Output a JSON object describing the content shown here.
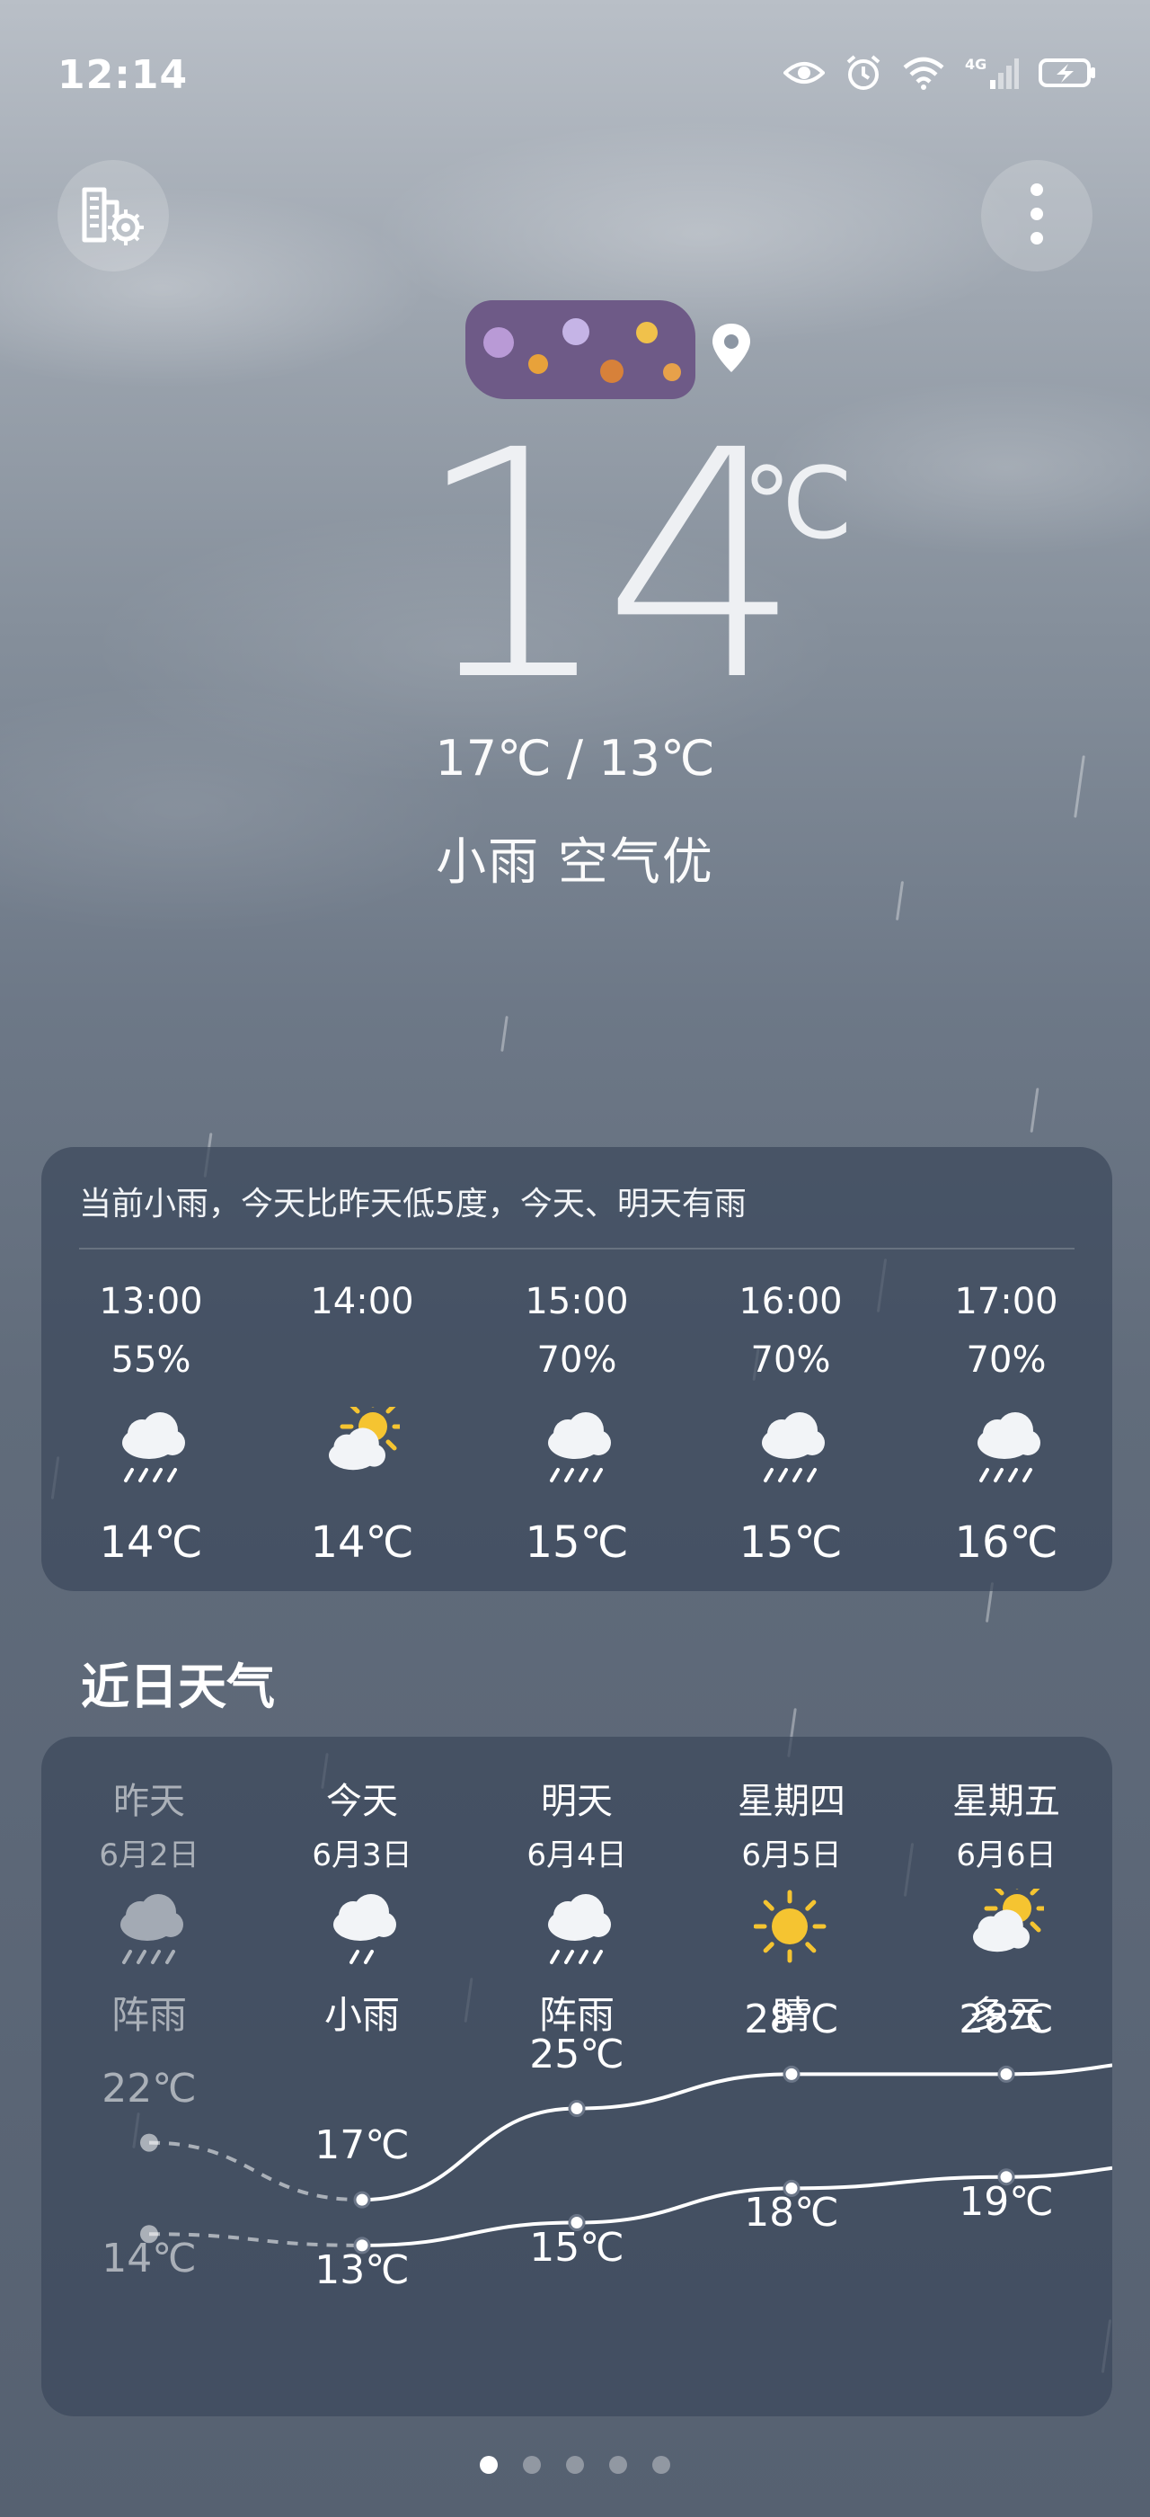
{
  "status_bar": {
    "time": "12:14",
    "network": "4G",
    "icons": [
      "eye-icon",
      "alarm-icon",
      "wifi-icon",
      "signal-icon",
      "battery-charging-icon"
    ]
  },
  "header": {
    "left_button_icon": "city-settings-icon",
    "right_button_icon": "more-icon"
  },
  "current": {
    "temperature": "14",
    "unit": "℃",
    "range": "17℃ / 13℃",
    "condition": "小雨  空气优"
  },
  "hourly": {
    "summary": "当前小雨，今天比昨天低5度，今天、明天有雨",
    "items": [
      {
        "time": "13:00",
        "precip": "55%",
        "icon": "rain",
        "temp": "14℃"
      },
      {
        "time": "14:00",
        "precip": "",
        "icon": "partly-cloudy",
        "temp": "14℃"
      },
      {
        "time": "15:00",
        "precip": "70%",
        "icon": "rain",
        "temp": "15℃"
      },
      {
        "time": "16:00",
        "precip": "70%",
        "icon": "rain",
        "temp": "15℃"
      },
      {
        "time": "17:00",
        "precip": "70%",
        "icon": "rain",
        "temp": "16℃"
      }
    ]
  },
  "daily": {
    "title": "近日天气",
    "days": [
      {
        "name": "昨天",
        "date": "6月2日",
        "icon": "heavy-rain",
        "condition": "阵雨",
        "high": 22,
        "low": 14,
        "high_label": "22℃",
        "low_label": "14℃",
        "past": true
      },
      {
        "name": "今天",
        "date": "6月3日",
        "icon": "light-rain",
        "condition": "小雨",
        "high": 17,
        "low": 13,
        "high_label": "17℃",
        "low_label": "13℃",
        "past": false
      },
      {
        "name": "明天",
        "date": "6月4日",
        "icon": "heavy-rain",
        "condition": "阵雨",
        "high": 25,
        "low": 15,
        "high_label": "25℃",
        "low_label": "15℃",
        "past": false
      },
      {
        "name": "星期四",
        "date": "6月5日",
        "icon": "sunny",
        "condition": "晴",
        "high": 28,
        "low": 18,
        "high_label": "28℃",
        "low_label": "18℃",
        "past": false
      },
      {
        "name": "星期五",
        "date": "6月6日",
        "icon": "partly-cloudy",
        "condition": "多云",
        "high": 28,
        "low": 19,
        "high_label": "28℃",
        "low_label": "19℃",
        "past": false
      }
    ]
  },
  "pager": {
    "count": 5,
    "active": 0
  },
  "colors": {
    "card": "#3c485c",
    "accent_sun": "#f5c431",
    "text": "#ffffff"
  }
}
